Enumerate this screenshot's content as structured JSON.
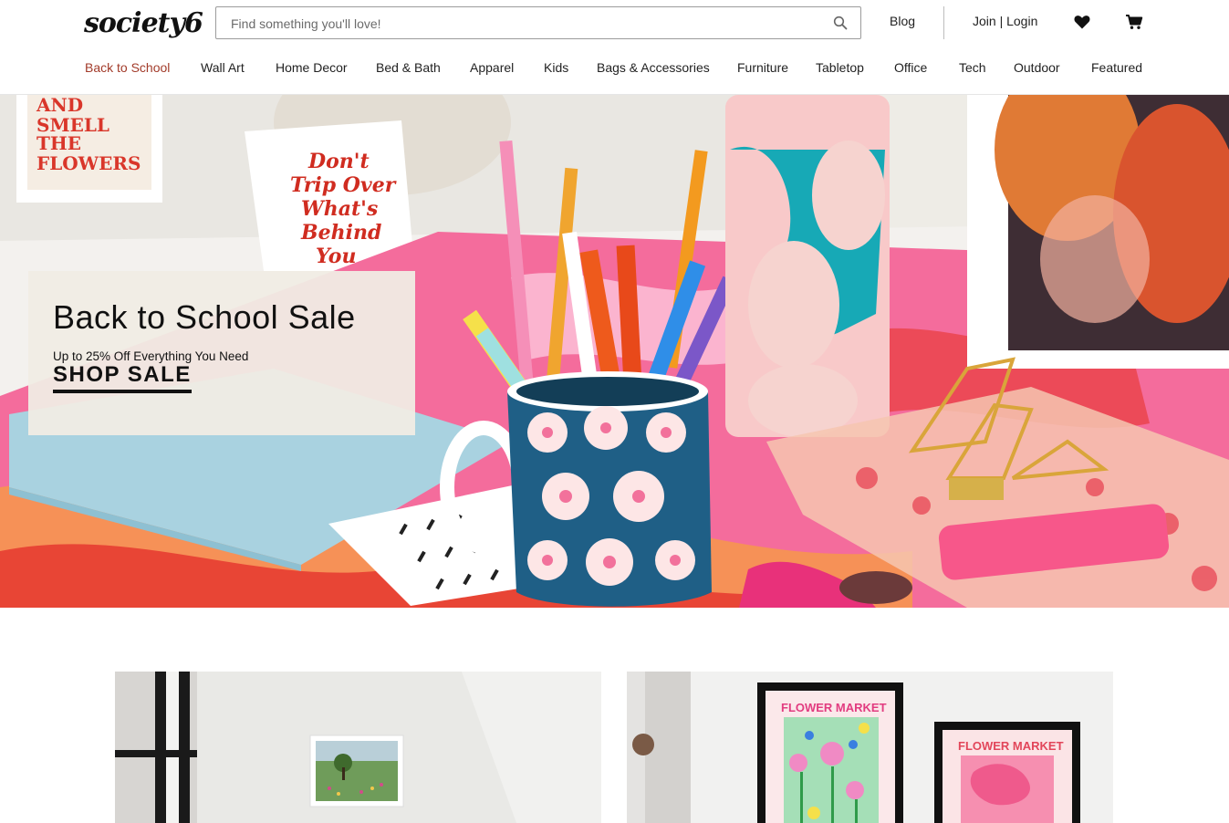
{
  "header": {
    "logo": "society6",
    "search": {
      "placeholder": "Find something you'll love!"
    },
    "blog_label": "Blog",
    "account_label": "Join | Login",
    "icons": [
      "search-icon",
      "heart-icon",
      "cart-icon"
    ]
  },
  "nav": {
    "items": [
      {
        "label": "Back to School",
        "active": true
      },
      {
        "label": "Wall Art"
      },
      {
        "label": "Home Decor"
      },
      {
        "label": "Bed & Bath"
      },
      {
        "label": "Apparel"
      },
      {
        "label": "Kids"
      },
      {
        "label": "Bags & Accessories"
      },
      {
        "label": "Furniture"
      },
      {
        "label": "Tabletop"
      },
      {
        "label": "Office"
      },
      {
        "label": "Tech"
      },
      {
        "label": "Outdoor"
      },
      {
        "label": "Featured"
      }
    ]
  },
  "hero": {
    "title": "Back to School Sale",
    "subtitle": "Up to 25% Off Everything You Need",
    "cta": "SHOP SALE",
    "card_text": [
      "Don't",
      "Trip Over",
      "What's",
      "Behind",
      "You"
    ],
    "print_text": [
      "AND",
      "SMELL",
      "THE",
      "FLOWERS"
    ]
  },
  "tiles": [
    {
      "name": "landscape-art-room"
    },
    {
      "name": "flower-market-prints",
      "print_labels": [
        "FLOWER MARKET",
        "FLOWER MARKET"
      ]
    }
  ],
  "colors": {
    "accent": "#a23b2a",
    "text": "#222222",
    "promo_bg": "#f0ece4"
  }
}
